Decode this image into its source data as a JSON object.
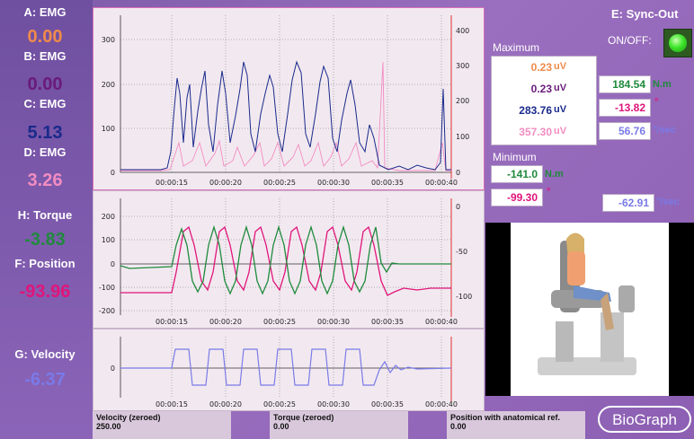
{
  "left_panel": {
    "a_label": "A: EMG",
    "a_value": "0.00",
    "b_label": "B: EMG",
    "b_value": "0.00",
    "c_label": "C: EMG",
    "c_value": "5.13",
    "d_label": "D: EMG",
    "d_value": "3.26",
    "h_label": "H: Torque",
    "h_value": "-3.83",
    "f_label": "F: Position",
    "f_value": "-93.96",
    "g_label": "G: Velocity",
    "g_value": "-6.37"
  },
  "colors": {
    "emg_a": "#f08a4b",
    "emg_b": "#6a1b7a",
    "emg_c": "#1a2a8c",
    "emg_d": "#f28cc2",
    "torque": "#1f8a3c",
    "position": "#e0157a",
    "velocity": "#7a7ae8"
  },
  "time_axis_labels": [
    "00:00:15",
    "00:00:20",
    "00:00:25",
    "00:00:30",
    "00:00:35",
    "00:00:40"
  ],
  "emg_chart": {
    "left_ticks": [
      "300",
      "200",
      "100",
      "0"
    ],
    "right_ticks": [
      "400",
      "300",
      "200",
      "100",
      "0"
    ]
  },
  "torque_chart": {
    "left_ticks": [
      "200",
      "100",
      "0",
      "-100",
      "-200"
    ],
    "right_ticks": [
      "0",
      "-50",
      "-100"
    ]
  },
  "velocity_chart": {
    "left_ticks": [
      "0"
    ]
  },
  "right_panel": {
    "sync_label": "E: Sync-Out",
    "onoff_label": "ON/OFF:",
    "maximum_label": "Maximum",
    "minimum_label": "Minimum",
    "max_emg": [
      {
        "value": "0.23",
        "unit": "uV"
      },
      {
        "value": "0.23",
        "unit": "uV"
      },
      {
        "value": "283.76",
        "unit": "uV"
      },
      {
        "value": "357.30",
        "unit": "uV"
      }
    ],
    "max_torque": {
      "value": "184.54",
      "unit": "N.m"
    },
    "max_position": {
      "value": "-13.82",
      "unit": "°"
    },
    "max_velocity": {
      "value": "56.76",
      "unit": "°/sec"
    },
    "min_torque": {
      "value": "-141.0",
      "unit": "N.m"
    },
    "min_position": {
      "value": "-99.30",
      "unit": "°"
    },
    "min_velocity": {
      "value": "-62.91",
      "unit": "°/sec"
    }
  },
  "bottom_bar": {
    "velocity_title": "Velocity (zeroed)",
    "velocity_value": "250.00",
    "torque_title": "Torque (zeroed)",
    "torque_value": "0.00",
    "position_title": "Position with anatomical ref.",
    "position_value": "0.00"
  },
  "logo_text": "BioGraph"
}
